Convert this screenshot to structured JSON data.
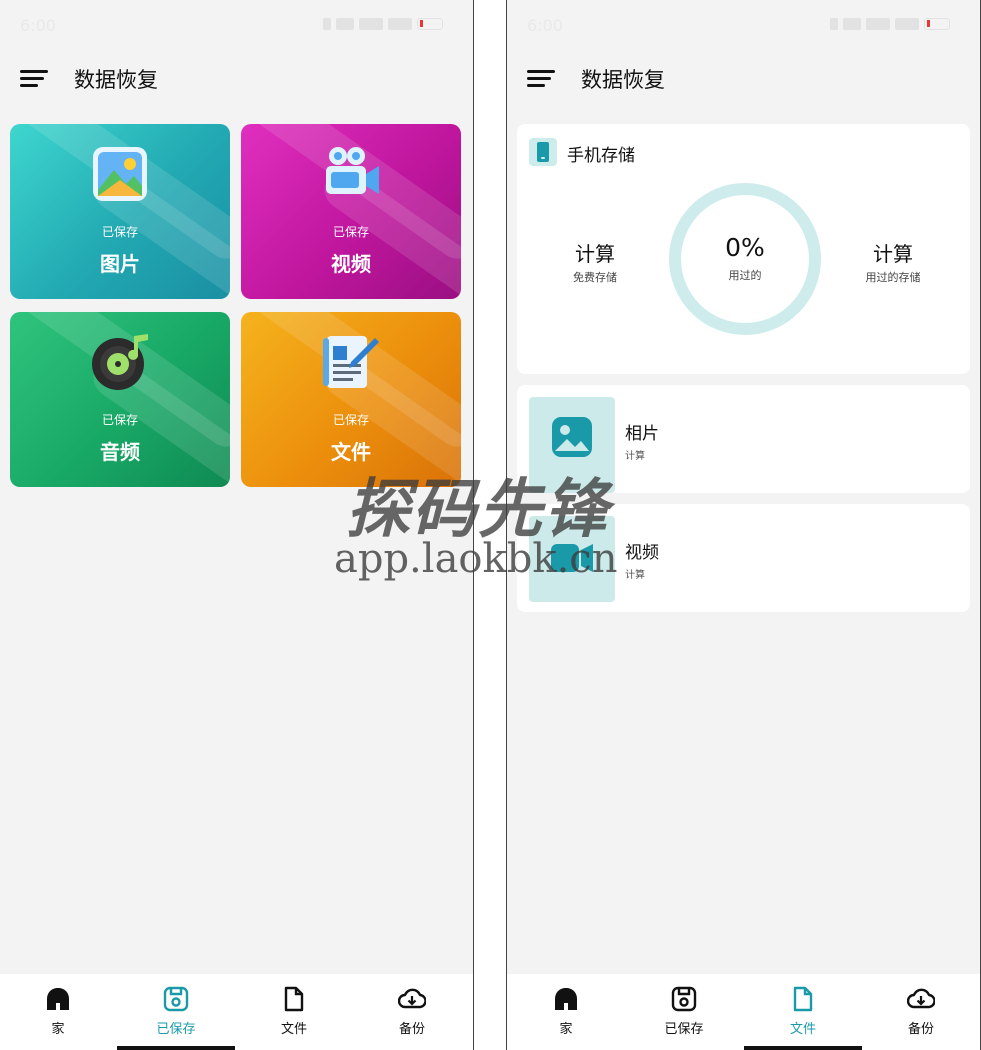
{
  "status_bar": {
    "time": "6:00"
  },
  "app": {
    "title": "数据恢复"
  },
  "saved_screen": {
    "tiles": [
      {
        "subtitle": "已保存",
        "label": "图片",
        "icon": "picture-icon"
      },
      {
        "subtitle": "已保存",
        "label": "视频",
        "icon": "video-camera-icon"
      },
      {
        "subtitle": "已保存",
        "label": "音频",
        "icon": "music-disc-icon"
      },
      {
        "subtitle": "已保存",
        "label": "文件",
        "icon": "document-icon"
      }
    ]
  },
  "files_screen": {
    "storage": {
      "title": "手机存储",
      "free_value": "计算",
      "free_label": "免费存储",
      "used_percent": "0%",
      "used_percent_label": "用过的",
      "used_value": "计算",
      "used_label": "用过的存储",
      "ring_color": "#cfecec",
      "used_fraction": 0
    },
    "media": [
      {
        "title": "相片",
        "subtitle": "计算",
        "icon": "image-icon"
      },
      {
        "title": "视频",
        "subtitle": "计算",
        "icon": "video-icon"
      }
    ]
  },
  "nav": {
    "items": [
      {
        "label": "家",
        "icon": "home-icon"
      },
      {
        "label": "已保存",
        "icon": "saved-icon"
      },
      {
        "label": "文件",
        "icon": "file-icon"
      },
      {
        "label": "备份",
        "icon": "cloud-backup-icon"
      }
    ],
    "left_active": 1,
    "right_active": 2
  },
  "colors": {
    "accent": "#1a9aa8",
    "background": "#f3f3f3"
  },
  "watermark": {
    "text_cn": "探码先锋",
    "text_en": "app.laokbk.cn"
  }
}
